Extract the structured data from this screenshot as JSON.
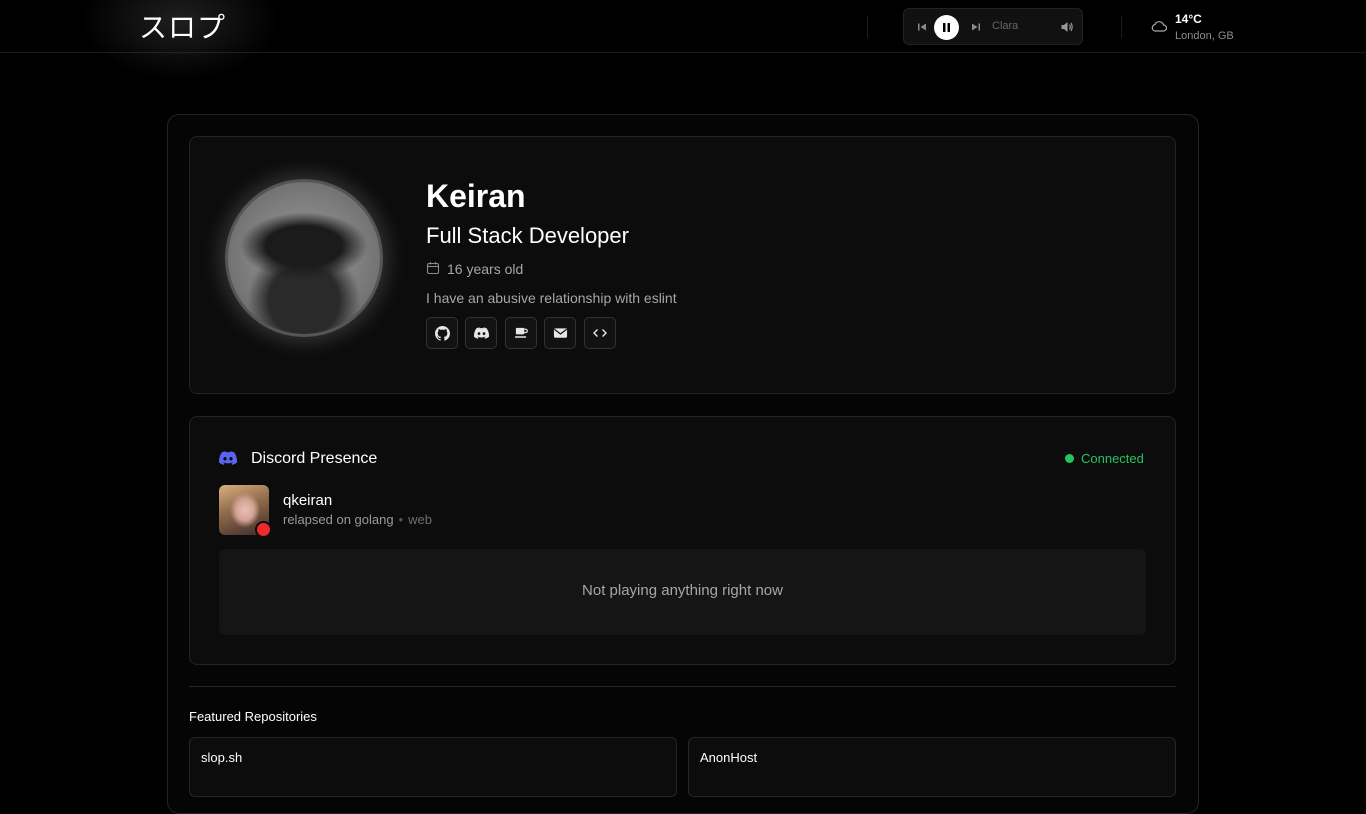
{
  "header": {
    "logo": "スロプ",
    "player": {
      "track": "Clara",
      "state": "playing"
    },
    "weather": {
      "temperature": "14°C",
      "location": "London, GB",
      "icon": "cloud-icon"
    }
  },
  "profile": {
    "name": "Keiran",
    "role": "Full Stack Developer",
    "age": "16 years old",
    "bio": "I have an abusive relationship with eslint",
    "socials": [
      "github-icon",
      "discord-icon",
      "coffee-icon",
      "mail-icon",
      "code-icon"
    ]
  },
  "discord": {
    "title": "Discord Presence",
    "status": "Connected",
    "username": "qkeiran",
    "activity": "relapsed on golang",
    "platform": "web",
    "empty_message": "Not playing anything right now",
    "colors": {
      "brand": "#5865F2",
      "connected": "#22c55e",
      "presence": "#ef2a2a"
    }
  },
  "repositories": {
    "heading": "Featured Repositories",
    "items": [
      {
        "name": "slop.sh"
      },
      {
        "name": "AnonHost"
      }
    ]
  }
}
